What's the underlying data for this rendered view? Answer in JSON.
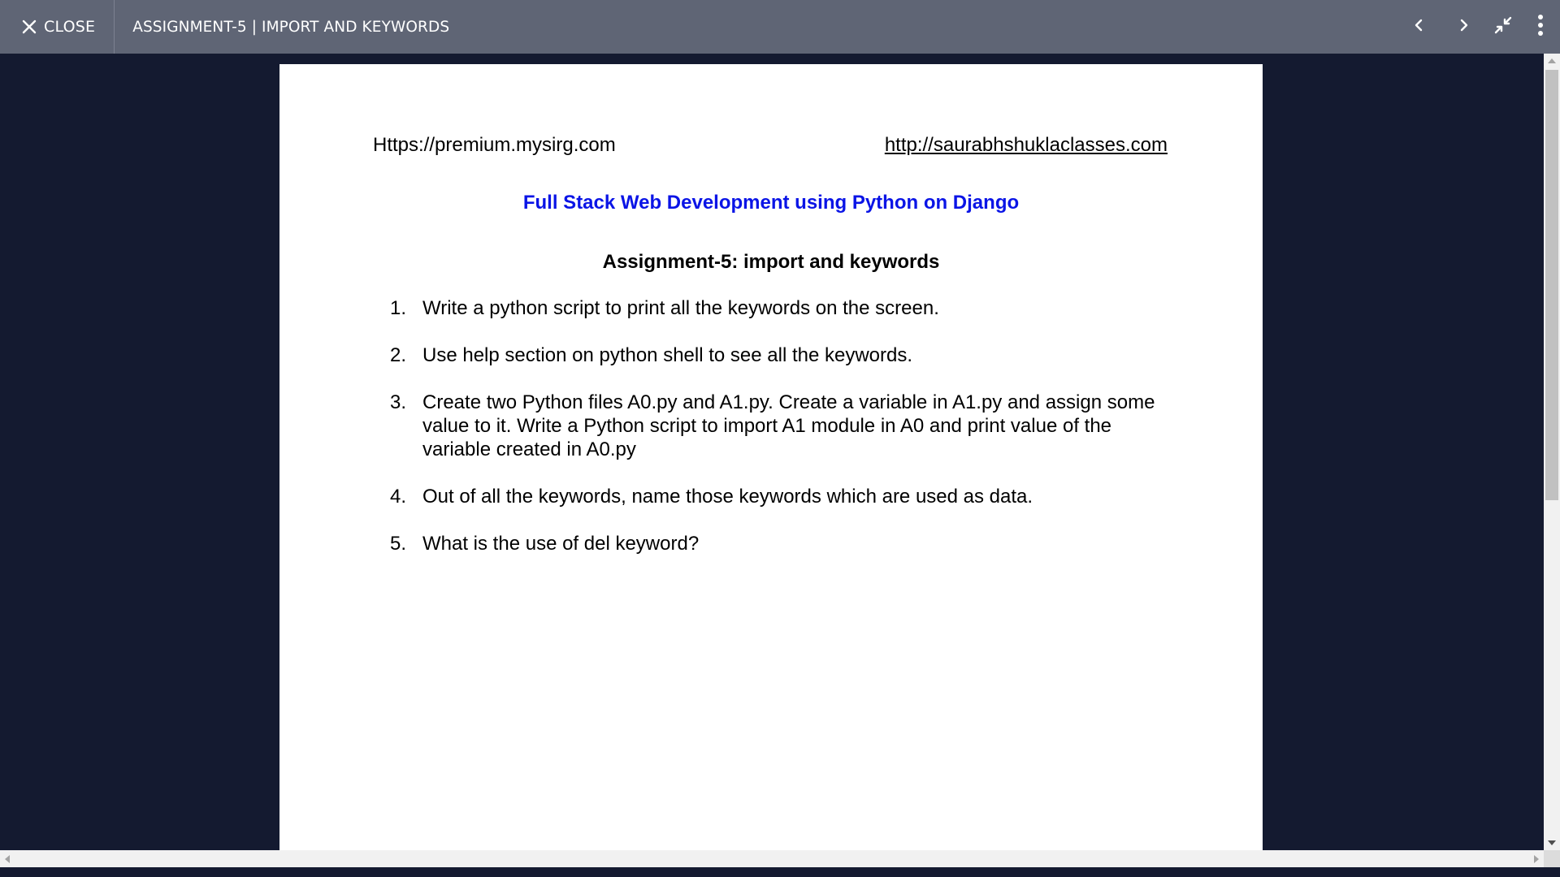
{
  "header": {
    "close_label": "CLOSE",
    "title": "ASSIGNMENT-5 | IMPORT AND KEYWORDS",
    "icons": [
      "close-icon",
      "chevron-left-icon",
      "chevron-right-icon",
      "collapse-icon",
      "more-vert-icon"
    ]
  },
  "document": {
    "url_left": "Https://premium.mysirg.com",
    "url_right": "http://saurabhshuklaclasses.com",
    "course_title": "Full Stack Web Development using Python on Django",
    "assignment_title": "Assignment-5: import and keywords",
    "questions": [
      {
        "num": "1.",
        "text": "Write a python script to print all the keywords on the screen."
      },
      {
        "num": "2.",
        "text": "Use help section on python shell to see all the keywords."
      },
      {
        "num": "3.",
        "text": "Create two Python files A0.py and A1.py. Create a variable in A1.py and assign some value to it. Write a Python script to import A1 module in A0 and print value of the variable created in A0.py"
      },
      {
        "num": "4.",
        "text": "Out of all the keywords, name those keywords which are used as data."
      },
      {
        "num": "5.",
        "text": "What is the use of del keyword?"
      }
    ]
  },
  "colors": {
    "topbar": "#5f6575",
    "viewer_background": "#141a30",
    "course_title": "#0a14e6"
  }
}
